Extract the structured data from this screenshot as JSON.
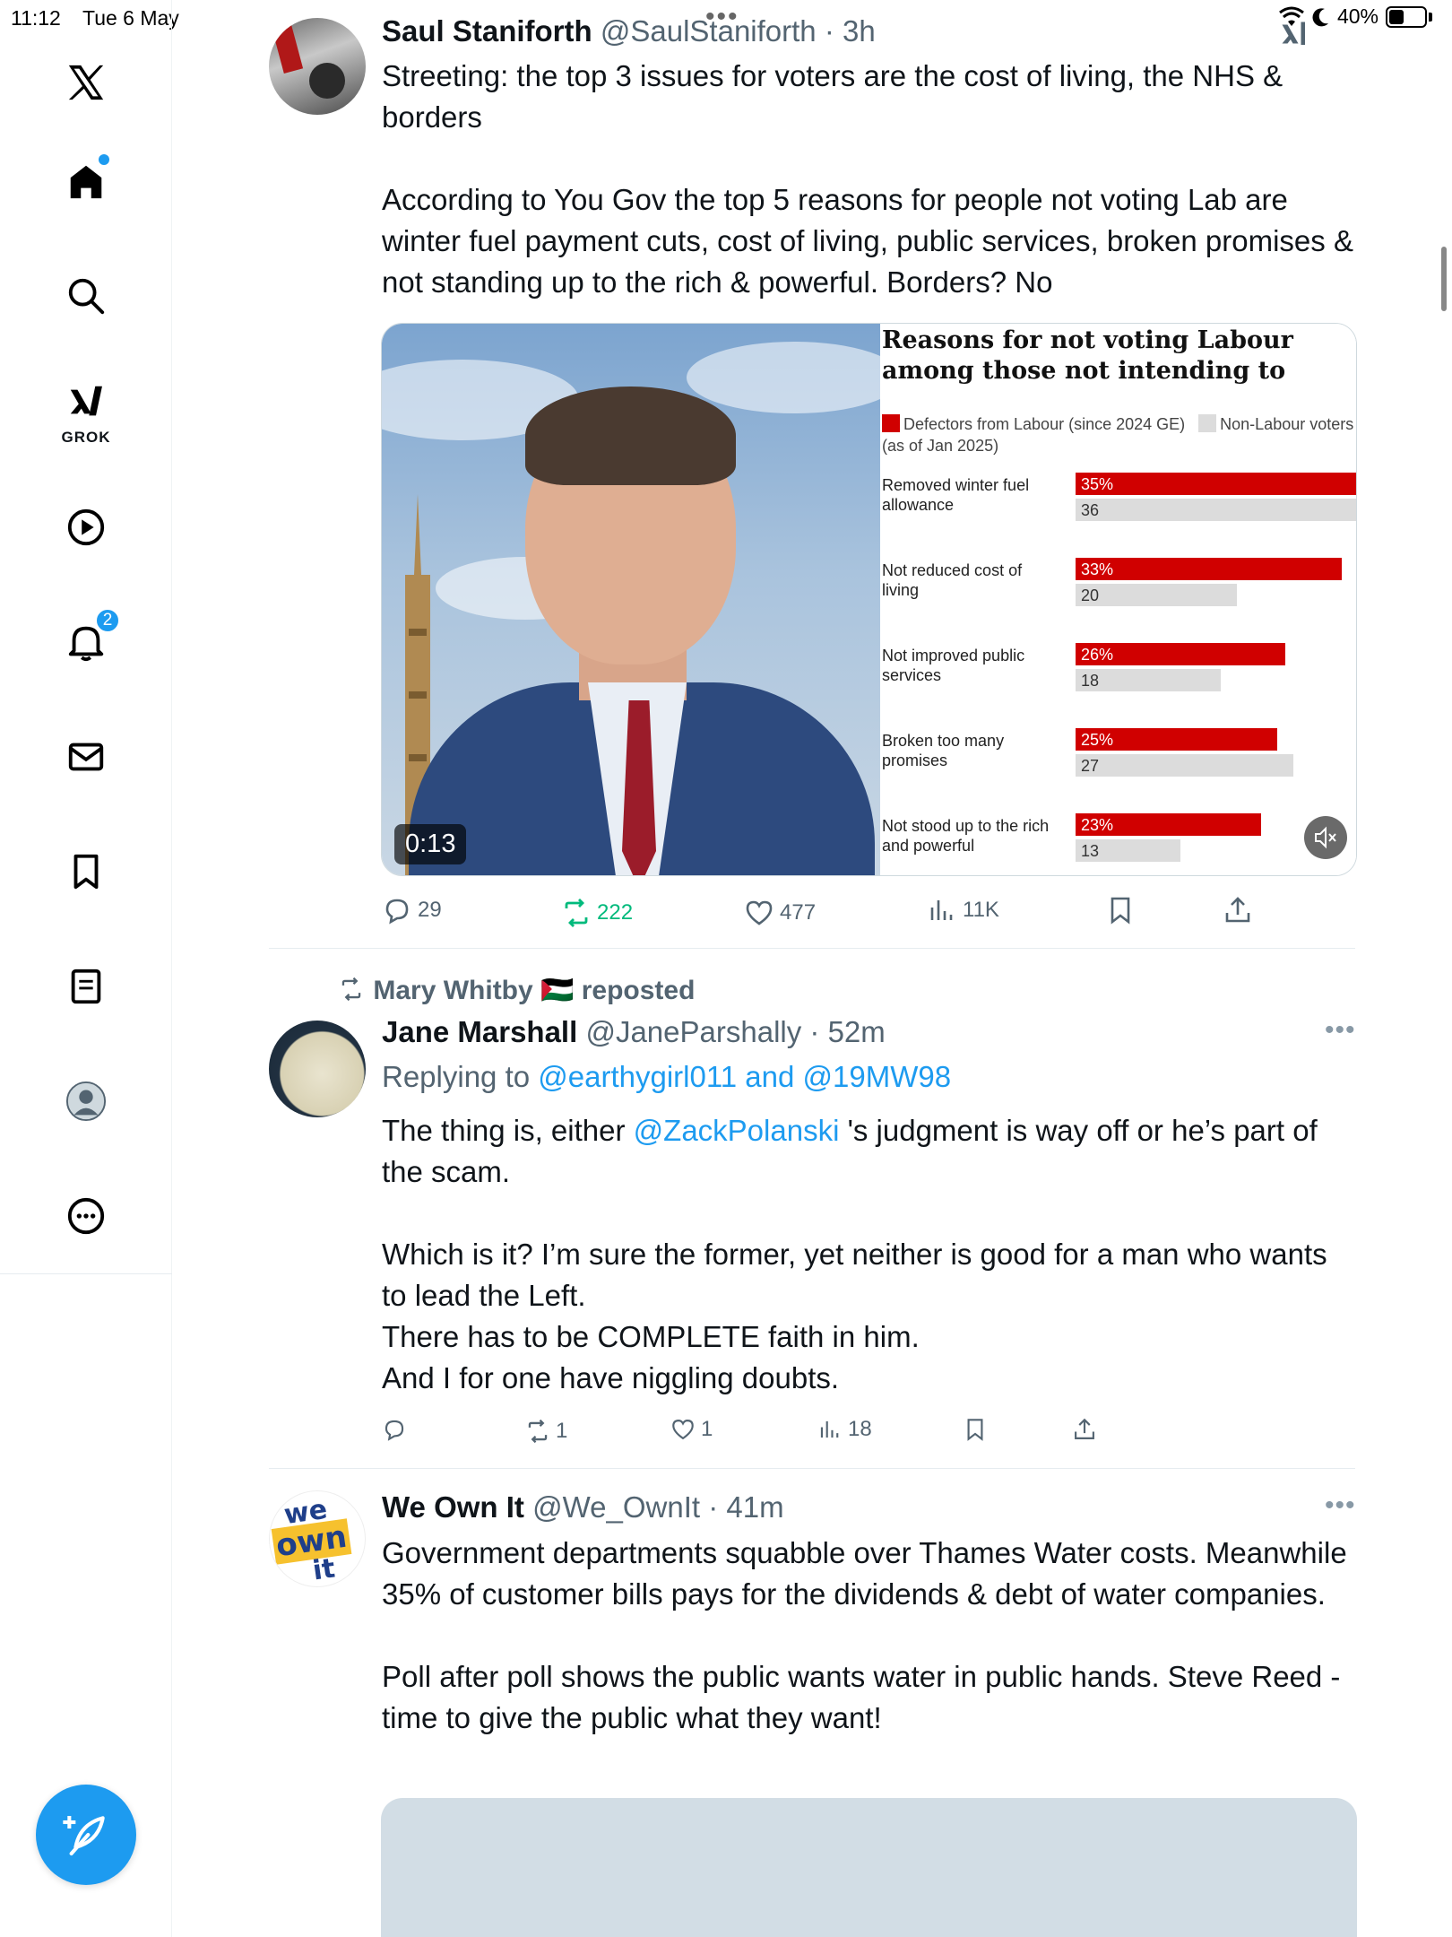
{
  "status_bar": {
    "time": "11:12",
    "date": "Tue 6 May",
    "battery_percent": "40%",
    "battery_level": 0.4
  },
  "sidebar": {
    "items": [
      {
        "name": "x-logo",
        "icon": "x-logo-icon"
      },
      {
        "name": "home",
        "icon": "home-icon"
      },
      {
        "name": "explore",
        "icon": "search-icon"
      },
      {
        "name": "grok",
        "icon": "grok-icon",
        "label": "GROK"
      },
      {
        "name": "video",
        "icon": "play-icon"
      },
      {
        "name": "notifications",
        "icon": "bell-icon",
        "badge": "2"
      },
      {
        "name": "messages",
        "icon": "mail-icon"
      },
      {
        "name": "bookmarks",
        "icon": "bookmark-icon"
      },
      {
        "name": "articles",
        "icon": "document-icon"
      },
      {
        "name": "profile",
        "icon": "avatar-icon"
      },
      {
        "name": "more",
        "icon": "more-circle-icon"
      }
    ],
    "accent_color": "#1d9bf0"
  },
  "tweets": [
    {
      "name": "Saul Staniforth",
      "handle": "@SaulStaniforth",
      "time": "3h",
      "text": "Streeting: the top 3 issues for voters are the cost of living, the NHS & borders\n\nAccording to You Gov the top 5 reasons for people not voting Lab are winter fuel payment cuts, cost of living, public services, broken promises & not standing up to the rich & powerful. Borders? No",
      "media": {
        "video_time": "0:13"
      },
      "actions": {
        "replies": "29",
        "reposts": "222",
        "likes": "477",
        "views": "11K"
      }
    },
    {
      "reposted_by": "Mary Whitby 🇵🇸",
      "reposted_label": "reposted",
      "name": "Jane Marshall",
      "handle": "@JaneParshally",
      "time": "52m",
      "replying_to_label": "Replying to",
      "replying_to": "@earthygirl011 and @19MW98",
      "text_before_mention": "The thing is, either ",
      "mention": "@ZackPolanski",
      "text_after_mention": " 's judgment is way off or he’s part of the scam.\n\nWhich is it? I’m sure the former, yet neither is good for a man who wants to lead the Left.\nThere has to be COMPLETE faith in him.\nAnd I for one have niggling doubts.",
      "actions": {
        "replies": "",
        "reposts": "1",
        "likes": "1",
        "views": "18"
      }
    },
    {
      "name": "We Own It",
      "handle": "@We_OwnIt",
      "time": "41m",
      "avatar_text": [
        "we",
        "own",
        "it"
      ],
      "text": "Government departments squabble over Thames Water costs. Meanwhile 35% of customer bills pays for the dividends & debt of water companies.\n\nPoll after poll shows the public wants water in public hands. Steve Reed - time to give the public what they want!"
    }
  ],
  "chart_data": {
    "type": "bar",
    "title": "Reasons for not voting Labour among those not intending to",
    "legend": [
      {
        "name": "Defectors from Labour (since 2024 GE)",
        "color": "#d00000"
      },
      {
        "name": "Non-Labour voters (as of Jan 2025)",
        "color": "#dcdcdc"
      }
    ],
    "categories": [
      "Removed winter fuel allowance",
      "Not reduced cost of living",
      "Not improved public services",
      "Broken too many promises",
      "Not stood up to the rich and powerful"
    ],
    "category_lines": [
      [
        "Removed winter fuel",
        "allowance"
      ],
      [
        "Not reduced cost of",
        "living"
      ],
      [
        "Not improved public",
        "services"
      ],
      [
        "Broken too many",
        "promises"
      ],
      [
        "Not stood up to the rich",
        "and powerful"
      ]
    ],
    "series": [
      {
        "name": "Defectors from Labour (since 2024 GE)",
        "values": [
          35,
          33,
          26,
          25,
          23
        ],
        "labels": [
          "35%",
          "33%",
          "26%",
          "25%",
          "23%"
        ],
        "color": "#d00000"
      },
      {
        "name": "Non-Labour voters (as of Jan 2025)",
        "values": [
          36,
          20,
          18,
          27,
          13
        ],
        "labels": [
          "36",
          "20",
          "18",
          "27",
          "13"
        ],
        "color": "#dcdcdc"
      }
    ],
    "xlim": [
      0,
      35
    ]
  }
}
